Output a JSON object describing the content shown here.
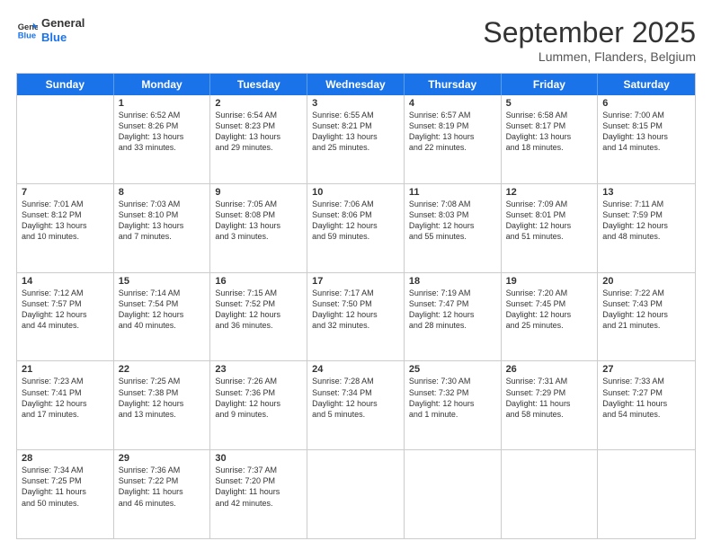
{
  "header": {
    "logo_line1": "General",
    "logo_line2": "Blue",
    "month_title": "September 2025",
    "location": "Lummen, Flanders, Belgium"
  },
  "weekdays": [
    "Sunday",
    "Monday",
    "Tuesday",
    "Wednesday",
    "Thursday",
    "Friday",
    "Saturday"
  ],
  "rows": [
    [
      {
        "day": "",
        "lines": []
      },
      {
        "day": "1",
        "lines": [
          "Sunrise: 6:52 AM",
          "Sunset: 8:26 PM",
          "Daylight: 13 hours",
          "and 33 minutes."
        ]
      },
      {
        "day": "2",
        "lines": [
          "Sunrise: 6:54 AM",
          "Sunset: 8:23 PM",
          "Daylight: 13 hours",
          "and 29 minutes."
        ]
      },
      {
        "day": "3",
        "lines": [
          "Sunrise: 6:55 AM",
          "Sunset: 8:21 PM",
          "Daylight: 13 hours",
          "and 25 minutes."
        ]
      },
      {
        "day": "4",
        "lines": [
          "Sunrise: 6:57 AM",
          "Sunset: 8:19 PM",
          "Daylight: 13 hours",
          "and 22 minutes."
        ]
      },
      {
        "day": "5",
        "lines": [
          "Sunrise: 6:58 AM",
          "Sunset: 8:17 PM",
          "Daylight: 13 hours",
          "and 18 minutes."
        ]
      },
      {
        "day": "6",
        "lines": [
          "Sunrise: 7:00 AM",
          "Sunset: 8:15 PM",
          "Daylight: 13 hours",
          "and 14 minutes."
        ]
      }
    ],
    [
      {
        "day": "7",
        "lines": [
          "Sunrise: 7:01 AM",
          "Sunset: 8:12 PM",
          "Daylight: 13 hours",
          "and 10 minutes."
        ]
      },
      {
        "day": "8",
        "lines": [
          "Sunrise: 7:03 AM",
          "Sunset: 8:10 PM",
          "Daylight: 13 hours",
          "and 7 minutes."
        ]
      },
      {
        "day": "9",
        "lines": [
          "Sunrise: 7:05 AM",
          "Sunset: 8:08 PM",
          "Daylight: 13 hours",
          "and 3 minutes."
        ]
      },
      {
        "day": "10",
        "lines": [
          "Sunrise: 7:06 AM",
          "Sunset: 8:06 PM",
          "Daylight: 12 hours",
          "and 59 minutes."
        ]
      },
      {
        "day": "11",
        "lines": [
          "Sunrise: 7:08 AM",
          "Sunset: 8:03 PM",
          "Daylight: 12 hours",
          "and 55 minutes."
        ]
      },
      {
        "day": "12",
        "lines": [
          "Sunrise: 7:09 AM",
          "Sunset: 8:01 PM",
          "Daylight: 12 hours",
          "and 51 minutes."
        ]
      },
      {
        "day": "13",
        "lines": [
          "Sunrise: 7:11 AM",
          "Sunset: 7:59 PM",
          "Daylight: 12 hours",
          "and 48 minutes."
        ]
      }
    ],
    [
      {
        "day": "14",
        "lines": [
          "Sunrise: 7:12 AM",
          "Sunset: 7:57 PM",
          "Daylight: 12 hours",
          "and 44 minutes."
        ]
      },
      {
        "day": "15",
        "lines": [
          "Sunrise: 7:14 AM",
          "Sunset: 7:54 PM",
          "Daylight: 12 hours",
          "and 40 minutes."
        ]
      },
      {
        "day": "16",
        "lines": [
          "Sunrise: 7:15 AM",
          "Sunset: 7:52 PM",
          "Daylight: 12 hours",
          "and 36 minutes."
        ]
      },
      {
        "day": "17",
        "lines": [
          "Sunrise: 7:17 AM",
          "Sunset: 7:50 PM",
          "Daylight: 12 hours",
          "and 32 minutes."
        ]
      },
      {
        "day": "18",
        "lines": [
          "Sunrise: 7:19 AM",
          "Sunset: 7:47 PM",
          "Daylight: 12 hours",
          "and 28 minutes."
        ]
      },
      {
        "day": "19",
        "lines": [
          "Sunrise: 7:20 AM",
          "Sunset: 7:45 PM",
          "Daylight: 12 hours",
          "and 25 minutes."
        ]
      },
      {
        "day": "20",
        "lines": [
          "Sunrise: 7:22 AM",
          "Sunset: 7:43 PM",
          "Daylight: 12 hours",
          "and 21 minutes."
        ]
      }
    ],
    [
      {
        "day": "21",
        "lines": [
          "Sunrise: 7:23 AM",
          "Sunset: 7:41 PM",
          "Daylight: 12 hours",
          "and 17 minutes."
        ]
      },
      {
        "day": "22",
        "lines": [
          "Sunrise: 7:25 AM",
          "Sunset: 7:38 PM",
          "Daylight: 12 hours",
          "and 13 minutes."
        ]
      },
      {
        "day": "23",
        "lines": [
          "Sunrise: 7:26 AM",
          "Sunset: 7:36 PM",
          "Daylight: 12 hours",
          "and 9 minutes."
        ]
      },
      {
        "day": "24",
        "lines": [
          "Sunrise: 7:28 AM",
          "Sunset: 7:34 PM",
          "Daylight: 12 hours",
          "and 5 minutes."
        ]
      },
      {
        "day": "25",
        "lines": [
          "Sunrise: 7:30 AM",
          "Sunset: 7:32 PM",
          "Daylight: 12 hours",
          "and 1 minute."
        ]
      },
      {
        "day": "26",
        "lines": [
          "Sunrise: 7:31 AM",
          "Sunset: 7:29 PM",
          "Daylight: 11 hours",
          "and 58 minutes."
        ]
      },
      {
        "day": "27",
        "lines": [
          "Sunrise: 7:33 AM",
          "Sunset: 7:27 PM",
          "Daylight: 11 hours",
          "and 54 minutes."
        ]
      }
    ],
    [
      {
        "day": "28",
        "lines": [
          "Sunrise: 7:34 AM",
          "Sunset: 7:25 PM",
          "Daylight: 11 hours",
          "and 50 minutes."
        ]
      },
      {
        "day": "29",
        "lines": [
          "Sunrise: 7:36 AM",
          "Sunset: 7:22 PM",
          "Daylight: 11 hours",
          "and 46 minutes."
        ]
      },
      {
        "day": "30",
        "lines": [
          "Sunrise: 7:37 AM",
          "Sunset: 7:20 PM",
          "Daylight: 11 hours",
          "and 42 minutes."
        ]
      },
      {
        "day": "",
        "lines": []
      },
      {
        "day": "",
        "lines": []
      },
      {
        "day": "",
        "lines": []
      },
      {
        "day": "",
        "lines": []
      }
    ]
  ]
}
